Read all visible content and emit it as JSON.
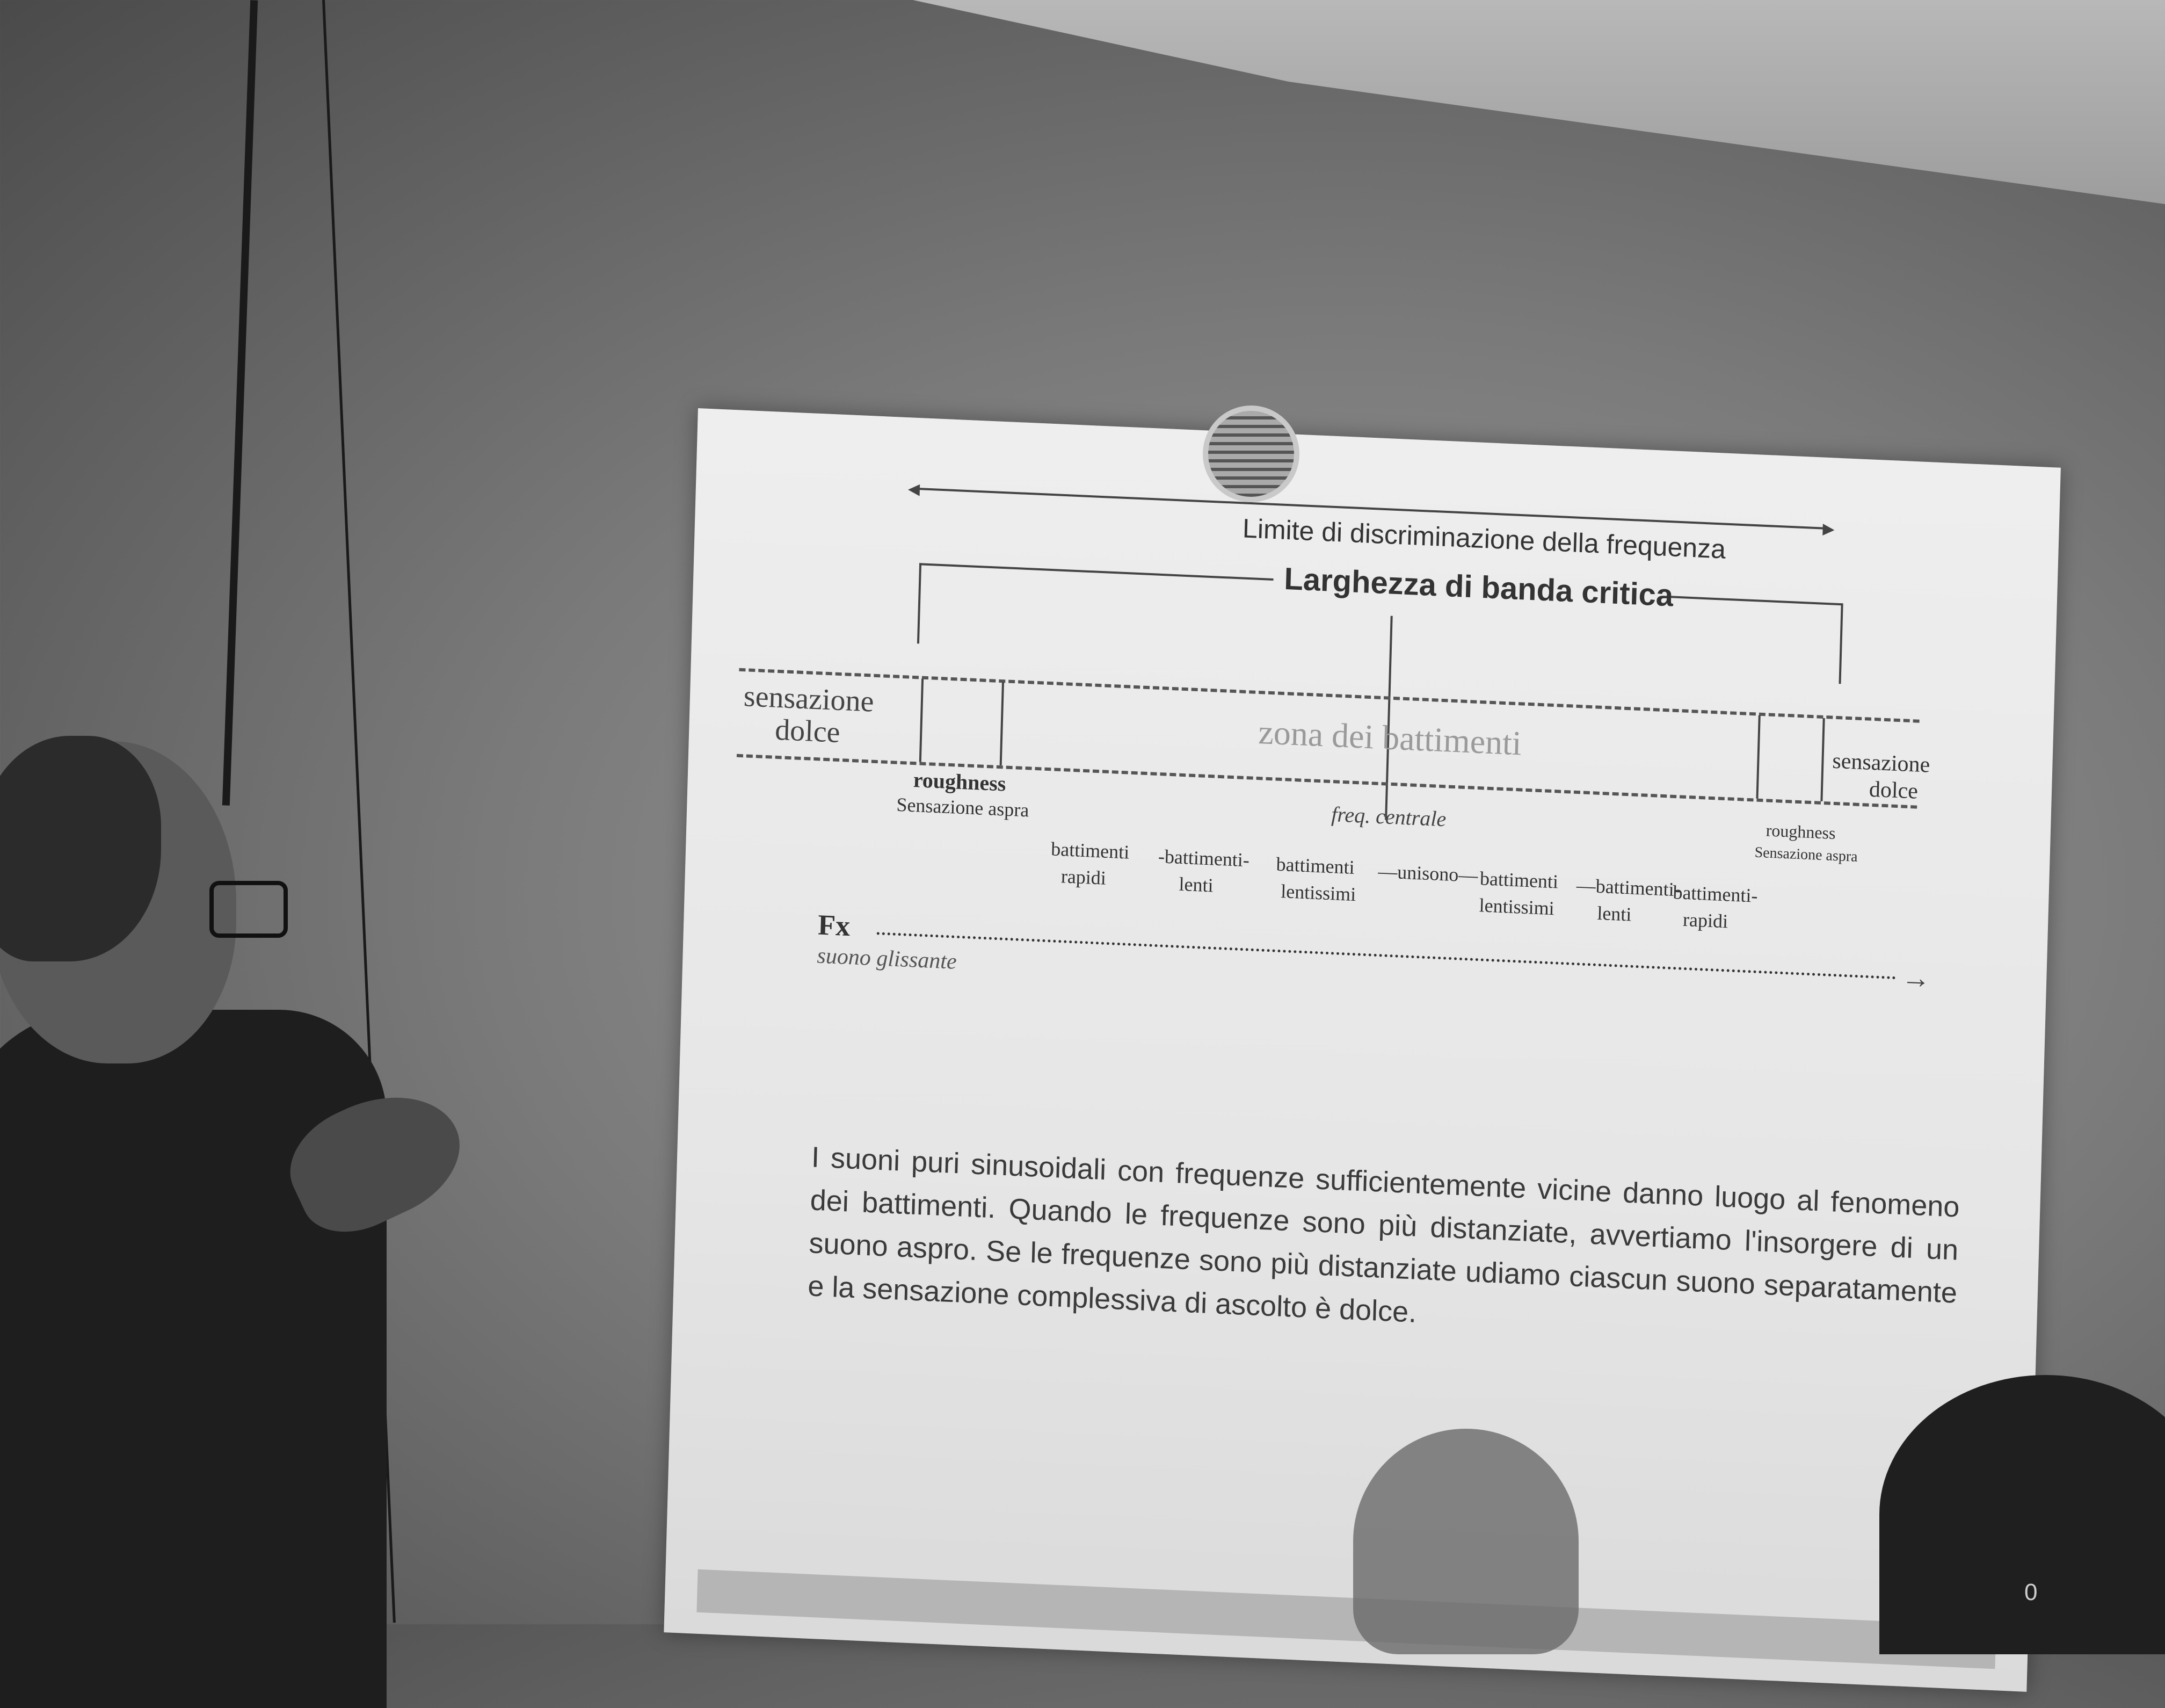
{
  "slide": {
    "top_arrow_label": "Limite di discriminazione della frequenza",
    "bracket_label": "Larghezza di banda critica",
    "left_soft": [
      "sensazione",
      "dolce"
    ],
    "right_soft": [
      "sensazione",
      "dolce"
    ],
    "zone_label": "zona dei battimenti",
    "left_roughness": [
      "roughness",
      "Sensazione aspra"
    ],
    "right_roughness": [
      "roughness",
      "Sensazione aspra"
    ],
    "center_label": "freq. centrale",
    "beats": [
      [
        "battimenti",
        "rapidi"
      ],
      [
        "-battimenti-",
        "lenti"
      ],
      [
        "battimenti",
        "lentissimi"
      ],
      [
        "—unisono—",
        ""
      ],
      [
        "battimenti",
        "lentissimi"
      ],
      [
        "—battimenti-",
        "lenti"
      ],
      [
        "battimenti-",
        "rapidi"
      ]
    ],
    "fx_label": "Fx",
    "glide_label": "suono glissante",
    "paragraph": "I suoni puri sinusoidali con frequenze sufficientemente vicine danno luogo al fenomeno dei battimenti. Quando le frequenze sono più distanziate, avvertiamo l'insorgere di un suono aspro. Se le frequenze sono più distanziate udiamo ciascun suono separatamente e la sensazione complessiva di ascolto è dolce."
  },
  "corner_mark": "0"
}
